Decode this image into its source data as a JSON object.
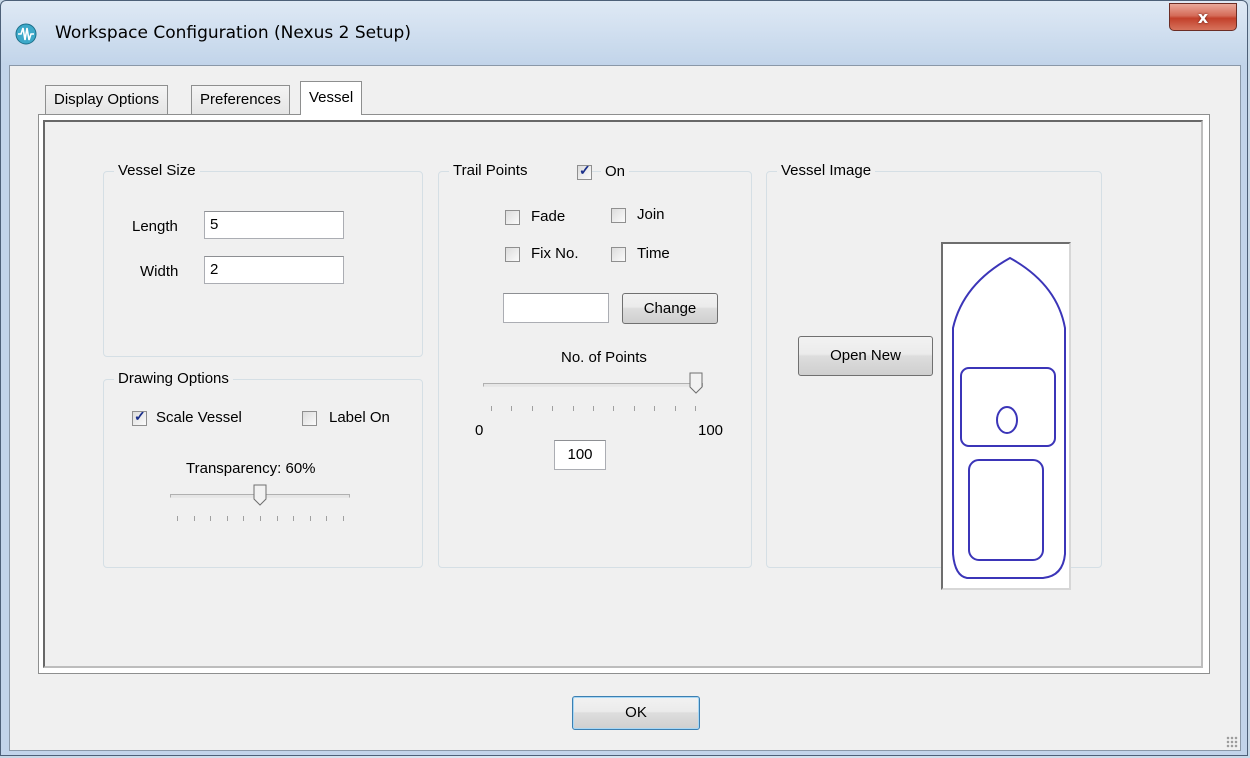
{
  "window": {
    "title": "Workspace Configuration (Nexus 2 Setup)",
    "close_glyph": "x"
  },
  "tabs": [
    {
      "label": "Display Options",
      "active": false
    },
    {
      "label": "Preferences",
      "active": false
    },
    {
      "label": "Vessel",
      "active": true
    }
  ],
  "vessel_size": {
    "title": "Vessel Size",
    "length_label": "Length",
    "length_value": "5",
    "width_label": "Width",
    "width_value": "2"
  },
  "drawing_options": {
    "title": "Drawing Options",
    "scale_vessel_label": "Scale Vessel",
    "scale_vessel_checked": true,
    "label_on_label": "Label On",
    "label_on_checked": false,
    "transparency_label": "Transparency: 60%",
    "transparency_fraction": 0.5
  },
  "trail_points": {
    "title": "Trail Points",
    "on_label": "On",
    "on_checked": true,
    "fade_label": "Fade",
    "fade_checked": false,
    "join_label": "Join",
    "join_checked": false,
    "fixno_label": "Fix No.",
    "fixno_checked": false,
    "time_label": "Time",
    "time_checked": false,
    "color_value": "",
    "change_label": "Change",
    "points_label": "No. of Points",
    "min_label": "0",
    "max_label": "100",
    "points_value": "100",
    "points_fraction": 1.0
  },
  "vessel_image": {
    "title": "Vessel Image",
    "open_new_label": "Open New",
    "outline_color": "#3b35b8"
  },
  "footer": {
    "ok_label": "OK"
  }
}
